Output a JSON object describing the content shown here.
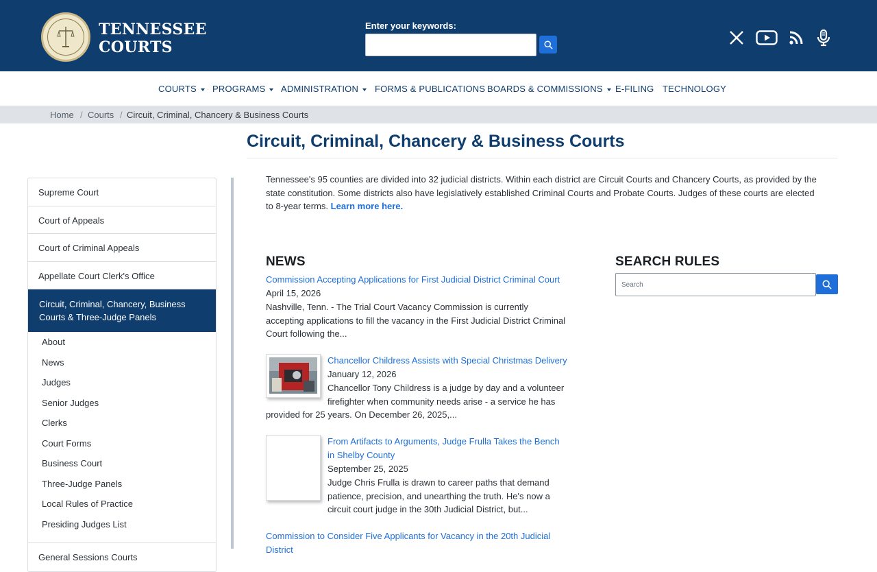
{
  "header": {
    "brand_line1": "TENNESSEE",
    "brand_line2": "COURTS",
    "search_label": "Enter your keywords:",
    "search_value": "",
    "social": [
      "x-icon",
      "youtube-icon",
      "rss-icon",
      "podcast-icon"
    ]
  },
  "nav": {
    "items": [
      {
        "label": "COURTS",
        "dropdown": true
      },
      {
        "label": "PROGRAMS",
        "dropdown": true
      },
      {
        "label": "ADMINISTRATION",
        "dropdown": true
      },
      {
        "label": "FORMS & PUBLICATIONS",
        "dropdown": false
      },
      {
        "label": "BOARDS & COMMISSIONS",
        "dropdown": true
      },
      {
        "label": "E-FILING",
        "dropdown": false
      },
      {
        "label": "TECHNOLOGY",
        "dropdown": false
      }
    ]
  },
  "breadcrumb": {
    "items": [
      "Home",
      "Courts",
      "Circuit, Criminal, Chancery & Business Courts"
    ]
  },
  "page": {
    "title": "Circuit, Criminal, Chancery & Business Courts",
    "intro": "Tennessee's 95 counties are divided into 32 judicial districts. Within each district are Circuit Courts and Chancery Courts, as provided by the state constitution. Some districts also have legislatively established Criminal Courts and Probate Courts. Judges of these courts are elected to 8-year terms.",
    "learn_more": "Learn more here."
  },
  "sidebar": {
    "items": [
      "Supreme Court",
      "Court of Appeals",
      "Court of Criminal Appeals",
      "Appellate Court Clerk's Office"
    ],
    "active": "Circuit, Criminal, Chancery, Business Courts & Three-Judge Panels",
    "sub_items": [
      "About",
      "News",
      "Judges",
      "Senior Judges",
      "Clerks",
      "Court Forms",
      "Business Court",
      "Three-Judge Panels",
      "Local Rules of Practice",
      "Presiding Judges List"
    ],
    "after": "General Sessions Courts"
  },
  "news": {
    "heading": "NEWS",
    "items": [
      {
        "title": "Commission Accepting Applications for First Judicial District Criminal Court",
        "date": "April 15, 2026",
        "body": "Nashville, Tenn. - The Trial Court Vacancy Commission is currently accepting applications to fill the vacancy in the First Judicial District Criminal Court following the..."
      },
      {
        "title": "Chancellor Childress Assists with Special Christmas Delivery",
        "date": "January 12, 2026",
        "body": "Chancellor Tony Childress is a judge by day and a volunteer firefighter when community needs arise - a service he has provided for 25 years. On December 26, 2025,..."
      },
      {
        "title": "From Artifacts to Arguments, Judge Frulla Takes the Bench in Shelby County",
        "date": "September 25, 2025",
        "body": "Judge Chris Frulla is drawn to career paths that demand patience, precision, and unearthing the truth. He's now a circuit court judge in the 30th Judicial District, but..."
      },
      {
        "title": "Commission to Consider Five Applicants for Vacancy in the 20th Judicial District"
      }
    ]
  },
  "rules": {
    "heading": "SEARCH RULES",
    "placeholder": "Search"
  }
}
